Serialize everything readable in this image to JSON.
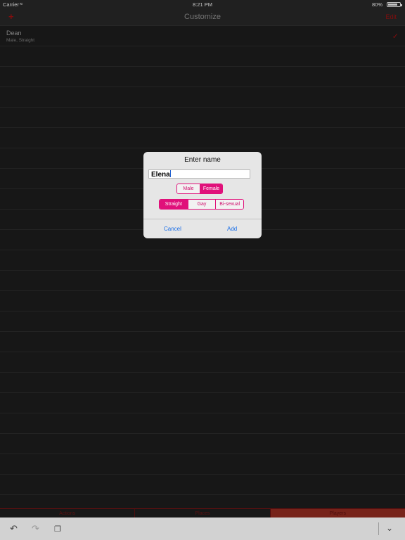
{
  "status": {
    "carrier": "Carrier",
    "time": "8:21 PM",
    "battery": "80%",
    "battery_level": 0.8
  },
  "nav": {
    "title": "Customize",
    "add_icon": "plus-icon",
    "edit_label": "Edit"
  },
  "players": [
    {
      "name": "Dean",
      "detail": "Male, Straight",
      "checked": true
    }
  ],
  "tabs": [
    {
      "label": "Actions",
      "active": false
    },
    {
      "label": "Places",
      "active": false
    },
    {
      "label": "Players",
      "active": true
    }
  ],
  "dialog": {
    "title": "Enter name",
    "name_value": "Elena",
    "gender": {
      "options": [
        "Male",
        "Female"
      ],
      "selected": "Female"
    },
    "orientation": {
      "options": [
        "Straight",
        "Gay",
        "Bi-sexual"
      ],
      "selected": "Straight"
    },
    "cancel_label": "Cancel",
    "add_label": "Add"
  },
  "toolbar": {
    "icons": [
      "undo-icon",
      "redo-icon",
      "copy-icon",
      "chevron-down-icon"
    ]
  },
  "colors": {
    "accent": "#e0107a",
    "nav_red": "#9a1010",
    "link": "#1a6ee8",
    "tab_active": "#8c2a1f"
  }
}
